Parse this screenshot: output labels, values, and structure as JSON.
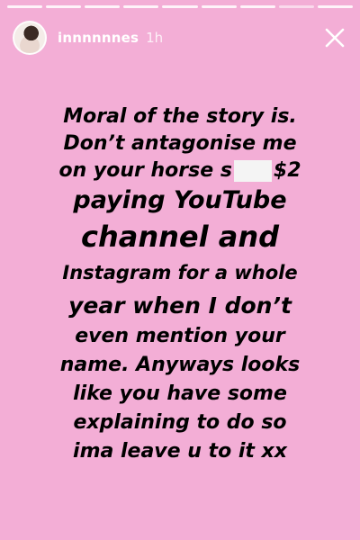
{
  "story": {
    "background_color": "#f3aed6",
    "progress_segments": 9,
    "current_segment": 8
  },
  "header": {
    "avatar_icon": "profile-photo",
    "username": "innnnnnes",
    "timestamp": "1h",
    "close_icon": "close-x-icon"
  },
  "message": {
    "line_1": "Moral of the story is.",
    "line_2": "Don’t antagonise me",
    "line_3_before": "on your horse s",
    "line_3_after": "$2",
    "line_4": "paying YouTube",
    "line_5": "channel and",
    "line_6": "Instagram for a whole",
    "line_7": "year when I don’t",
    "line_8": "even mention your",
    "line_9": "name. Anyways looks",
    "line_10": "like you have some",
    "line_11": "explaining to do so",
    "line_12": "ima leave u to it xx"
  }
}
